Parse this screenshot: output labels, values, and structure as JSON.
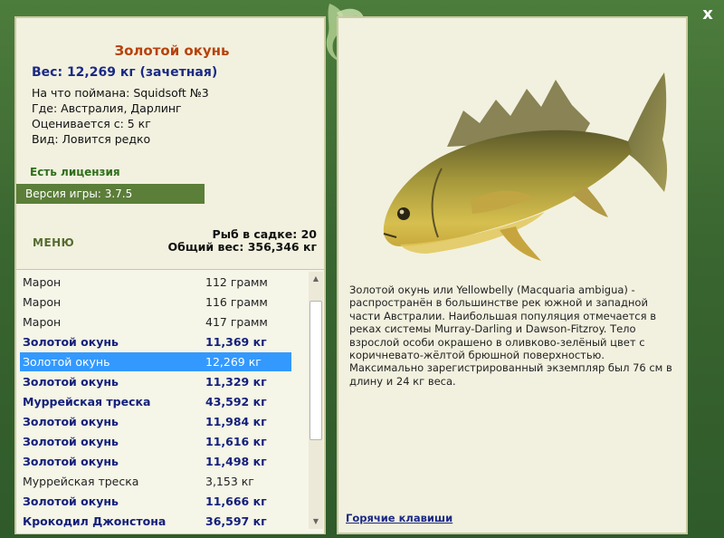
{
  "window": {
    "close_label": "x"
  },
  "fish": {
    "title": "Золотой окунь",
    "weight_line": "Вес: 12,269 кг (зачетная)",
    "info": [
      "На что поймана: Squidsoft №3",
      "Где: Австралия, Дарлинг",
      "Оценивается с: 5 кг",
      "Вид: Ловится редко"
    ],
    "description": "Золотой окунь или Yellowbelly (Macquaria ambigua) - распространён в большинстве рек южной и западной части Австралии. Наибольшая популяция отмечается в реках системы Murray-Darling и Dawson-Fitzroy. Тело взрослой особи окрашено в оливково-зелёный цвет с коричневато-жёлтой брюшной поверхностью. Максимально зарегистрированный экземпляр был 76 см в длину и 24 кг веса."
  },
  "license": "Есть лицензия",
  "version": "Версия игры: 3.7.5",
  "menu_label": "МЕНЮ",
  "cage": {
    "count_line": "Рыб в садке: 20",
    "total_line": "Общий вес: 356,346 кг"
  },
  "catch_list": [
    {
      "name": "Марон",
      "weight": "112 грамм",
      "style": "normal"
    },
    {
      "name": "Марон",
      "weight": "116 грамм",
      "style": "normal"
    },
    {
      "name": "Марон",
      "weight": "417 грамм",
      "style": "normal"
    },
    {
      "name": "Золотой окунь",
      "weight": "11,369 кг",
      "style": "trophy"
    },
    {
      "name": "Золотой окунь",
      "weight": "12,269 кг",
      "style": "selected"
    },
    {
      "name": "Золотой окунь",
      "weight": "11,329 кг",
      "style": "trophy"
    },
    {
      "name": "Муррейская треска",
      "weight": "43,592 кг",
      "style": "trophy"
    },
    {
      "name": "Золотой окунь",
      "weight": "11,984 кг",
      "style": "trophy"
    },
    {
      "name": "Золотой окунь",
      "weight": "11,616 кг",
      "style": "trophy"
    },
    {
      "name": "Золотой окунь",
      "weight": "11,498 кг",
      "style": "trophy"
    },
    {
      "name": "Муррейская треска",
      "weight": "3,153 кг",
      "style": "normal"
    },
    {
      "name": "Золотой окунь",
      "weight": "11,666 кг",
      "style": "trophy"
    },
    {
      "name": "Крокодил Джонстона",
      "weight": "36,597 кг",
      "style": "trophy"
    }
  ],
  "hotkeys_label": "Горячие клавиши",
  "icons": {
    "close": "close-icon",
    "ornament": "leaf-ornament-icon",
    "scroll_up": "scroll-up-arrow-icon",
    "scroll_down": "scroll-down-arrow-icon",
    "fish_picture": "golden-perch-image"
  },
  "colors": {
    "frame": "#3e6b33",
    "panel": "#f2f1df",
    "title": "#b8420b",
    "trophy_text": "#14207a",
    "selection": "#3399ff",
    "version_bar": "#5b7e39"
  }
}
